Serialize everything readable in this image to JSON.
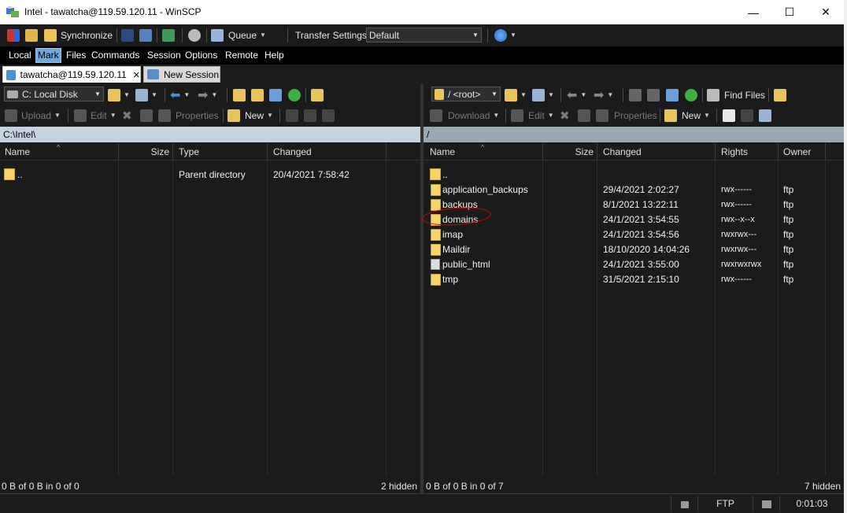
{
  "window": {
    "title": "Intel - tawatcha@119.59.120.11 - WinSCP",
    "minimize_glyph": "—",
    "maximize_glyph": "☐",
    "close_glyph": "✕"
  },
  "toolbar": {
    "synchronize_label": "Synchronize",
    "queue_label": "Queue",
    "transfer_settings_label": "Transfer Settings",
    "transfer_settings_value": "Default"
  },
  "menubar": {
    "items": [
      "Local",
      "Mark",
      "Files",
      "Commands",
      "Session",
      "Options",
      "Remote",
      "Help"
    ],
    "active_index": 1
  },
  "sessions": {
    "tabs": [
      {
        "label": "tawatcha@119.59.120.11"
      },
      {
        "label": "New Session"
      }
    ],
    "close_glyph": "✕"
  },
  "left_panel": {
    "drive_label": "C: Local Disk",
    "actions": {
      "upload": "Upload",
      "edit": "Edit",
      "properties": "Properties",
      "new": "New"
    },
    "path": "C:\\Intel\\",
    "columns": [
      "Name",
      "Size",
      "Type",
      "Changed"
    ],
    "files": [
      {
        "name": "..",
        "size": "",
        "type": "Parent directory",
        "changed": "20/4/2021  7:58:42"
      }
    ],
    "status_left": "0 B of 0 B in 0 of 0",
    "status_right": "2 hidden"
  },
  "right_panel": {
    "location_label": "/ <root>",
    "find_files_label": "Find Files",
    "actions": {
      "download": "Download",
      "edit": "Edit",
      "properties": "Properties",
      "new": "New"
    },
    "path": "/",
    "columns": [
      "Name",
      "Size",
      "Changed",
      "Rights",
      "Owner"
    ],
    "files": [
      {
        "name": "..",
        "size": "",
        "changed": "",
        "rights": "",
        "owner": "",
        "kind": "parent"
      },
      {
        "name": "application_backups",
        "size": "",
        "changed": "29/4/2021 2:02:27",
        "rights": "rwx------",
        "owner": "ftp",
        "kind": "folder"
      },
      {
        "name": "backups",
        "size": "",
        "changed": "8/1/2021 13:22:11",
        "rights": "rwx------",
        "owner": "ftp",
        "kind": "folder"
      },
      {
        "name": "domains",
        "size": "",
        "changed": "24/1/2021 3:54:55",
        "rights": "rwx--x--x",
        "owner": "ftp",
        "kind": "folder"
      },
      {
        "name": "imap",
        "size": "",
        "changed": "24/1/2021 3:54:56",
        "rights": "rwxrwx---",
        "owner": "ftp",
        "kind": "folder"
      },
      {
        "name": "Maildir",
        "size": "",
        "changed": "18/10/2020 14:04:26",
        "rights": "rwxrwx---",
        "owner": "ftp",
        "kind": "folder"
      },
      {
        "name": "public_html",
        "size": "",
        "changed": "24/1/2021 3:55:00",
        "rights": "rwxrwxrwx",
        "owner": "ftp",
        "kind": "link"
      },
      {
        "name": "tmp",
        "size": "",
        "changed": "31/5/2021 2:15:10",
        "rights": "rwx------",
        "owner": "ftp",
        "kind": "folder"
      }
    ],
    "status_left": "0 B of 0 B in 0 of 7",
    "status_right": "7 hidden"
  },
  "statusbar": {
    "protocol": "FTP",
    "elapsed": "0:01:03"
  },
  "colors": {
    "background": "#1b1b1b",
    "active_path_bar": "#c5d3e0",
    "folder": "#f6d36b",
    "annotation": "#dd0000"
  }
}
